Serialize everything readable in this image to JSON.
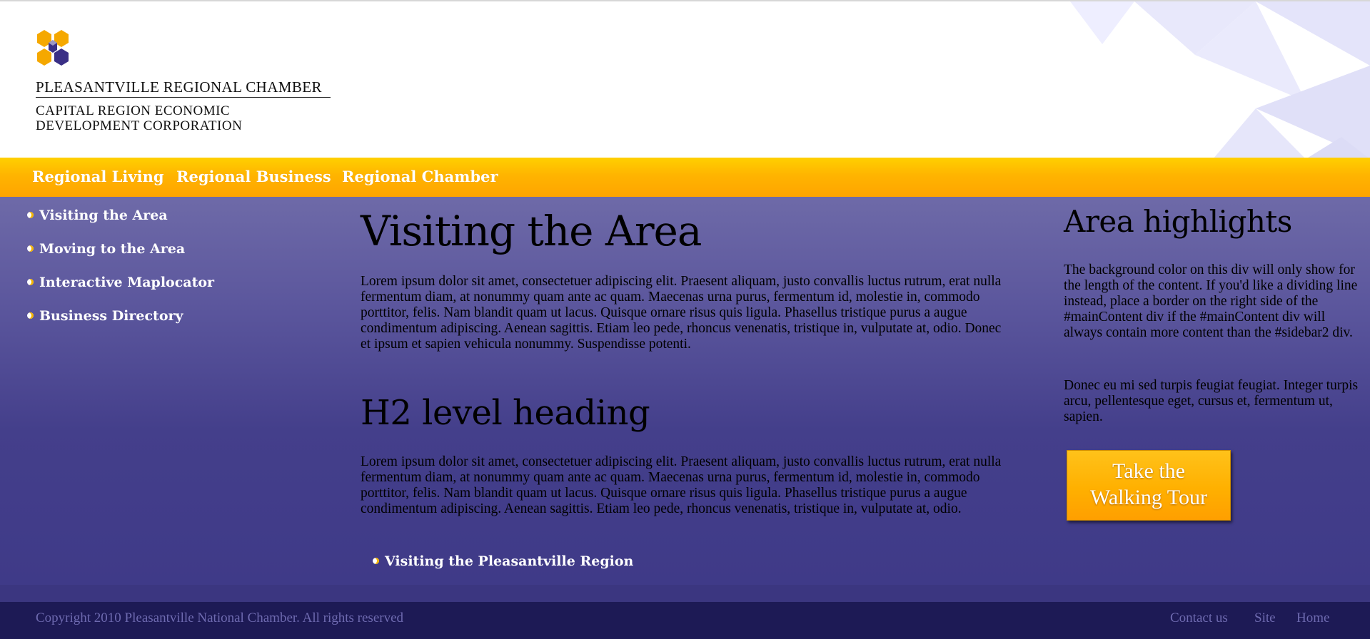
{
  "header": {
    "org_name": "PLEASANTVILLE REGIONAL CHAMBER",
    "org_sub_line1": "CAPITAL REGION ECONOMIC",
    "org_sub_line2": "DEVELOPMENT CORPORATION",
    "colors": {
      "logo_gold": "#f5a800",
      "logo_purple": "#3a2f86"
    }
  },
  "topnav": {
    "items": [
      {
        "label": "Regional Living"
      },
      {
        "label": "Regional Business"
      },
      {
        "label": "Regional Chamber"
      }
    ]
  },
  "sidebar": {
    "items": [
      {
        "label": "Visiting the Area"
      },
      {
        "label": "Moving to the Area"
      },
      {
        "label": "Interactive Maplocator"
      },
      {
        "label": "Business Directory"
      }
    ]
  },
  "main": {
    "title": "Visiting the Area",
    "para1": "Lorem ipsum dolor sit amet, consectetuer adipiscing elit. Praesent aliquam, justo convallis luctus rutrum, erat nulla fermentum diam, at nonummy quam ante ac quam. Maecenas urna purus, fermentum id, molestie in, commodo porttitor, felis. Nam blandit quam ut lacus. Quisque ornare risus quis ligula. Phasellus tristique purus a augue condimentum adipiscing. Aenean sagittis. Etiam leo pede, rhoncus venenatis, tristique in, vulputate at, odio. Donec et ipsum et sapien vehicula nonummy. Suspendisse potenti.",
    "h2": "H2 level heading",
    "para2": "Lorem ipsum dolor sit amet, consectetuer adipiscing elit. Praesent aliquam, justo convallis luctus rutrum, erat nulla fermentum diam, at nonummy quam ante ac quam. Maecenas urna purus, fermentum id, molestie in, commodo porttitor, felis. Nam blandit quam ut lacus. Quisque ornare risus quis ligula. Phasellus tristique purus a augue condimentum adipiscing. Aenean sagittis. Etiam leo pede, rhoncus venenatis, tristique in, vulputate at, odio.",
    "link": "Visiting the Pleasantville Region"
  },
  "highlights": {
    "title": "Area highlights",
    "para1": "The background color on this div will only show for the length of the content. If you'd like a dividing line instead, place a border on the right side of the #mainContent div if the #mainContent div will always contain more content than the #sidebar2 div.",
    "para2": "Donec eu mi sed turpis feugiat feugiat. Integer turpis arcu, pellentesque eget, cursus et, fermentum ut, sapien.",
    "tour_line1": "Take the",
    "tour_line2": "Walking Tour"
  },
  "footer": {
    "copyright": "Copyright 2010 Pleasantville National Chamber. All rights reserved",
    "links": [
      {
        "label": "Contact us"
      },
      {
        "label": "Site"
      },
      {
        "label": "Home"
      }
    ]
  }
}
